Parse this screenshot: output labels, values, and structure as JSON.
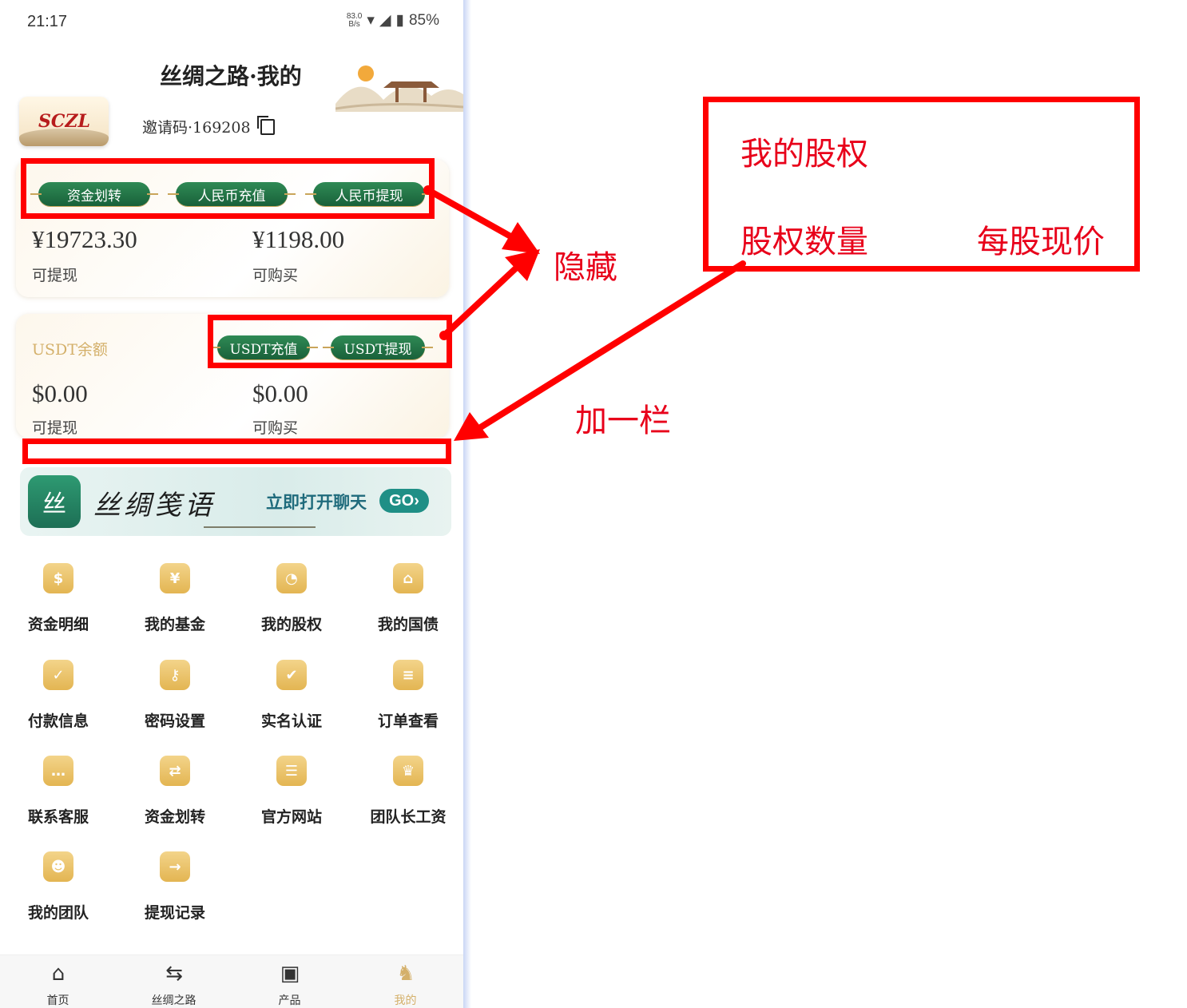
{
  "status_bar": {
    "time": "21:17",
    "net_speed_value": "83.0",
    "net_speed_unit": "B/s",
    "battery": "85%"
  },
  "header": {
    "title": "丝绸之路·我的"
  },
  "profile": {
    "logo_text": "SCZL",
    "invite_code": "邀请码·169208"
  },
  "wallet_card": {
    "buttons": [
      "资金划转",
      "人民币充值",
      "人民币提现"
    ],
    "withdrawable_amount": "¥19723.30",
    "withdrawable_label": "可提现",
    "purchasable_amount": "¥1198.00",
    "purchasable_label": "可购买"
  },
  "usdt_card": {
    "title": "USDT余额",
    "buttons": [
      "USDT充值",
      "USDT提现"
    ],
    "withdrawable_amount": "$0.00",
    "withdrawable_label": "可提现",
    "purchasable_amount": "$0.00",
    "purchasable_label": "可购买"
  },
  "banner": {
    "icon_text": "丝",
    "title": "丝绸笺语",
    "cta": "立即打开聊天",
    "go": "GO›"
  },
  "menu": [
    {
      "label": "资金明细",
      "icon": "money-bag-icon",
      "glyph": "$"
    },
    {
      "label": "我的基金",
      "icon": "wallet-icon",
      "glyph": "¥"
    },
    {
      "label": "我的股权",
      "icon": "pie-chart-icon",
      "glyph": "◔"
    },
    {
      "label": "我的国债",
      "icon": "bank-icon",
      "glyph": "⌂"
    },
    {
      "label": "付款信息",
      "icon": "clipboard-icon",
      "glyph": "✓"
    },
    {
      "label": "密码设置",
      "icon": "user-key-icon",
      "glyph": "⚷"
    },
    {
      "label": "实名认证",
      "icon": "id-card-icon",
      "glyph": "✔"
    },
    {
      "label": "订单查看",
      "icon": "document-icon",
      "glyph": "≡"
    },
    {
      "label": "联系客服",
      "icon": "chat-icon",
      "glyph": "…"
    },
    {
      "label": "资金划转",
      "icon": "transfer-icon",
      "glyph": "⇄"
    },
    {
      "label": "官方网站",
      "icon": "website-icon",
      "glyph": "☰"
    },
    {
      "label": "团队长工资",
      "icon": "leader-icon",
      "glyph": "♛"
    },
    {
      "label": "我的团队",
      "icon": "team-icon",
      "glyph": "☻"
    },
    {
      "label": "提现记录",
      "icon": "withdraw-record-icon",
      "glyph": "→"
    }
  ],
  "tabbar": [
    {
      "label": "首页",
      "icon": "home-icon",
      "glyph": "⌂"
    },
    {
      "label": "丝绸之路",
      "icon": "signpost-icon",
      "glyph": "⇆"
    },
    {
      "label": "产品",
      "icon": "box-icon",
      "glyph": "▣"
    },
    {
      "label": "我的",
      "icon": "camel-icon",
      "glyph": "♞"
    }
  ],
  "annotations": {
    "hide_note": "隐藏",
    "add_row_note": "加一栏",
    "mockup_title": "我的股权",
    "mockup_col1": "股权数量",
    "mockup_col2": "每股现价"
  },
  "colors": {
    "annotation_red": "#ff0000",
    "primary_green": "#1f6b40",
    "gold": "#d4b06a"
  }
}
